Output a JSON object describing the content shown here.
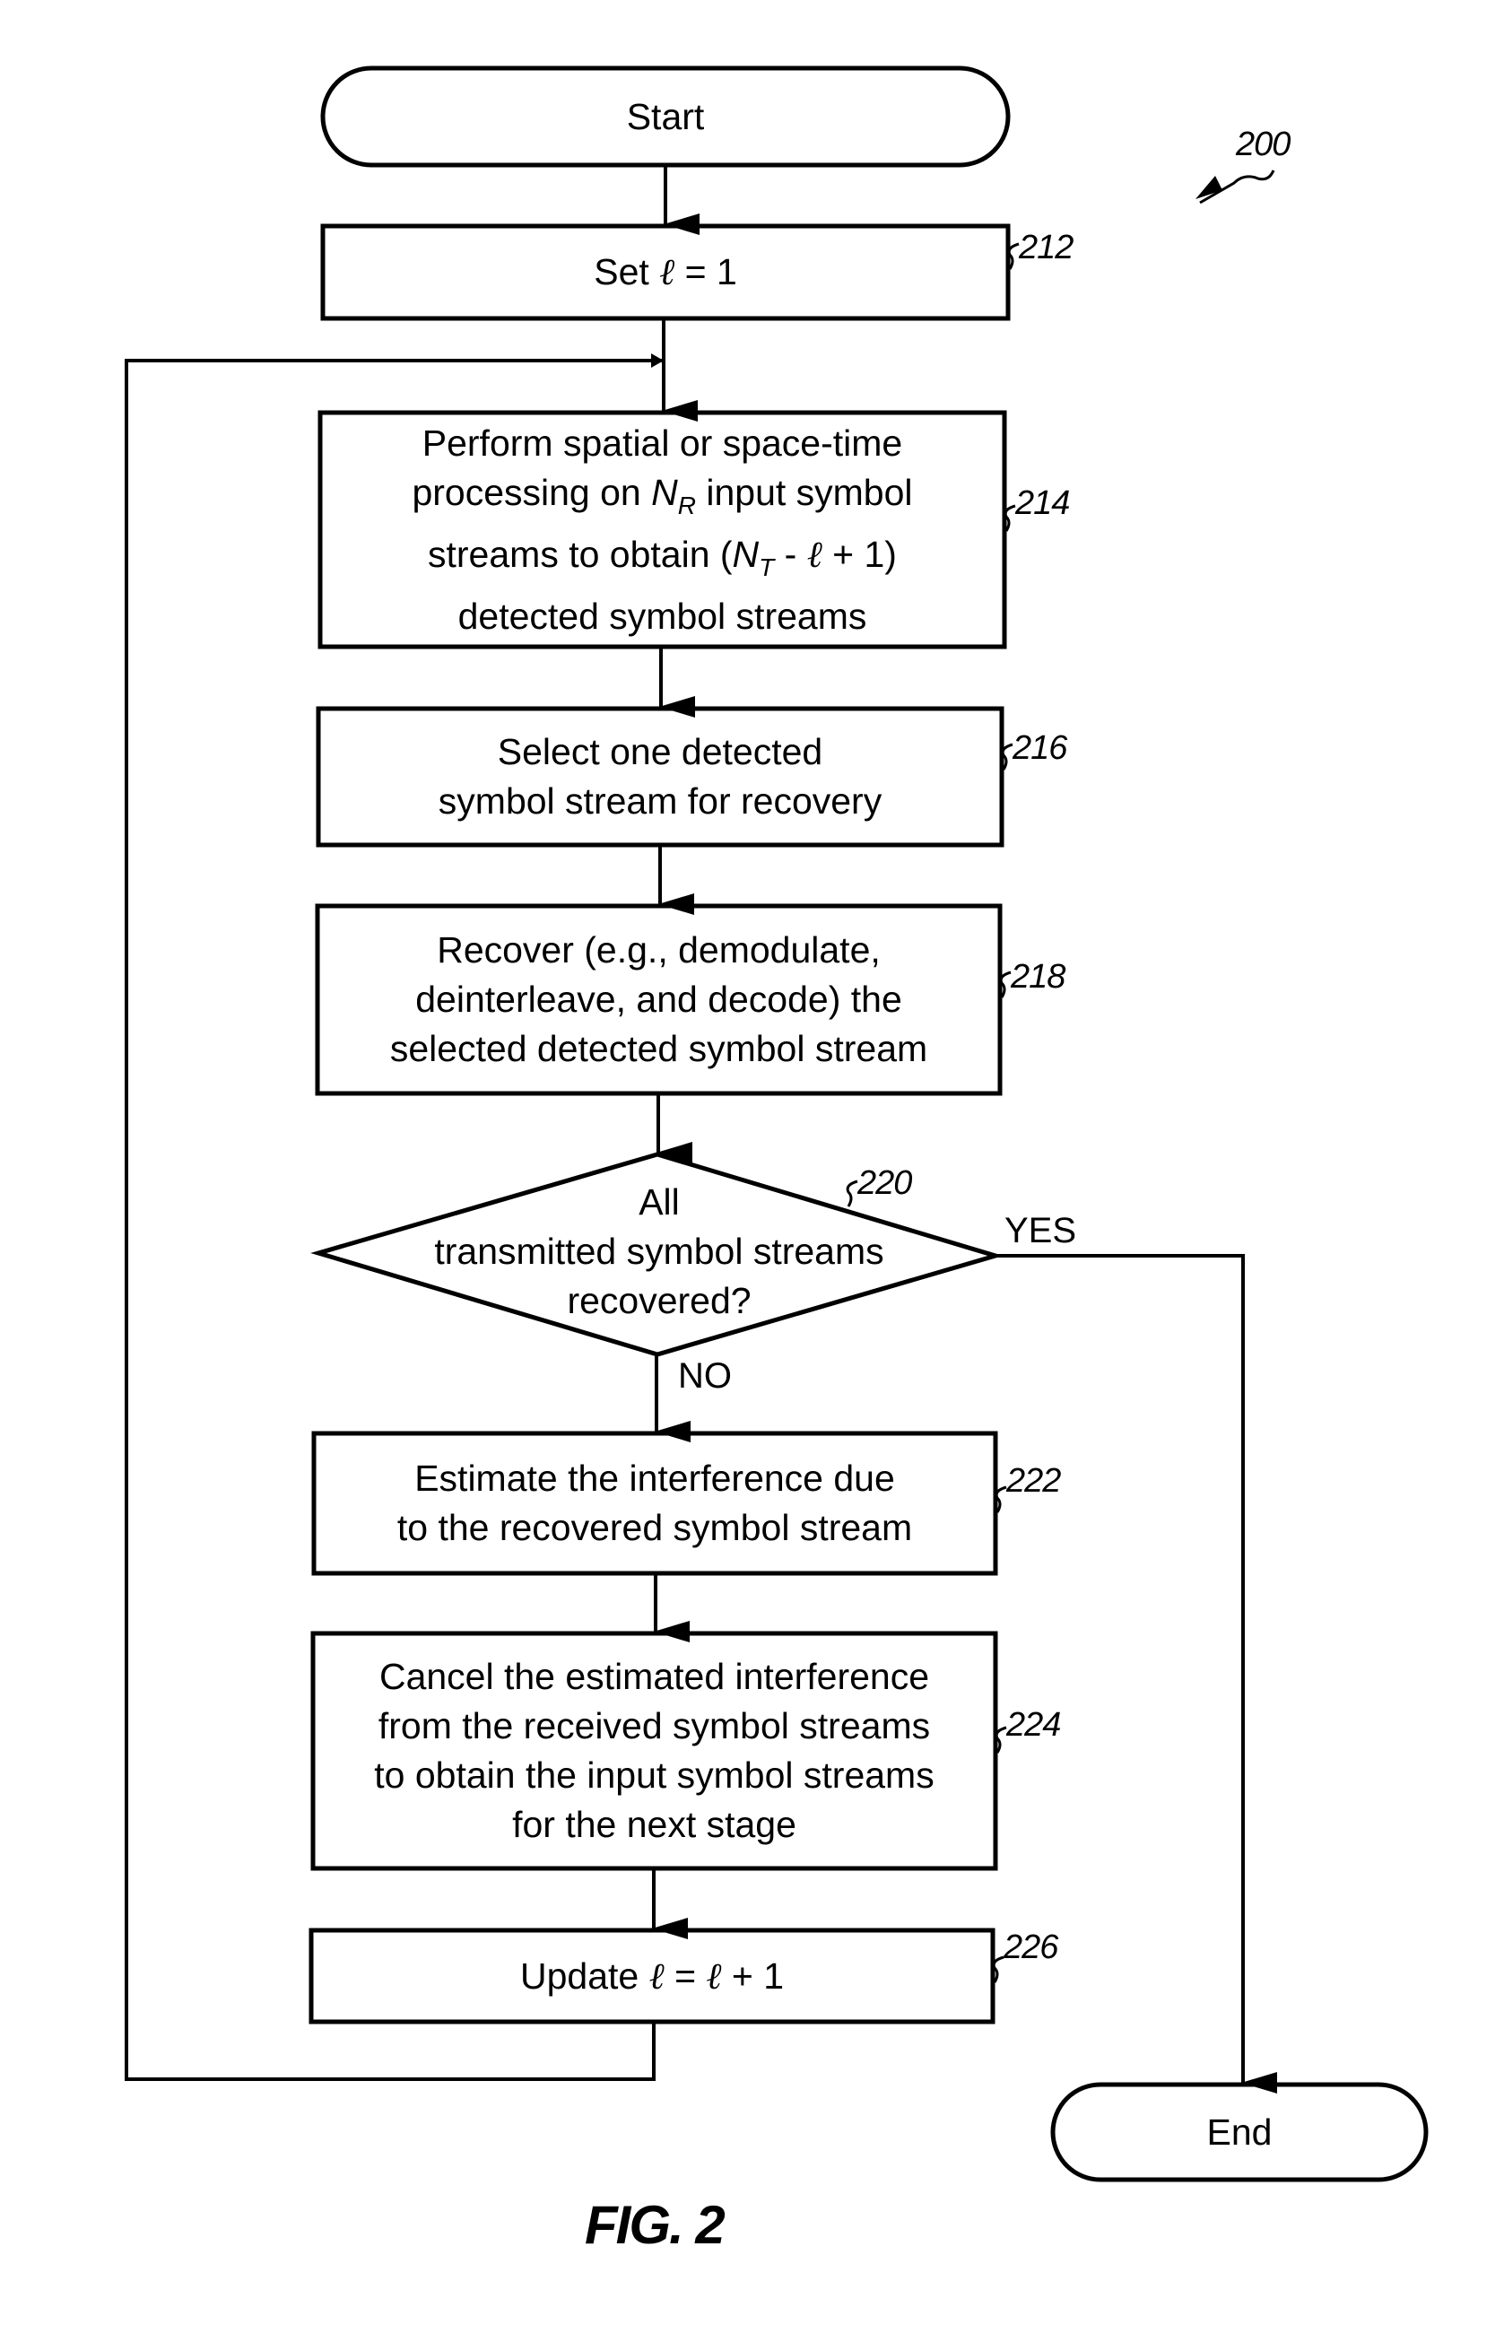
{
  "figure": {
    "label": "FIG. 2",
    "reference": "200"
  },
  "nodes": {
    "start": {
      "type": "terminator",
      "text": "Start"
    },
    "n212": {
      "type": "process",
      "ref": "212",
      "text_prefix": "Set ",
      "var": "ℓ",
      "text_suffix": " = 1"
    },
    "n214": {
      "type": "process",
      "ref": "214",
      "line1": "Perform spatial or space-time",
      "line2_a": "processing on ",
      "line2_var": "N",
      "line2_sub": "R",
      "line2_b": " input symbol",
      "line3_a": "streams to obtain (",
      "line3_var": "N",
      "line3_sub": "T",
      "line3_b": " - ",
      "line3_ell": "ℓ",
      "line3_c": " + 1)",
      "line4": "detected symbol streams"
    },
    "n216": {
      "type": "process",
      "ref": "216",
      "text": "Select one detected\nsymbol stream for recovery"
    },
    "n218": {
      "type": "process",
      "ref": "218",
      "text": "Recover (e.g., demodulate,\ndeinterleave, and decode) the\nselected detected symbol stream"
    },
    "n220": {
      "type": "decision",
      "ref": "220",
      "text": "All\ntransmitted symbol streams\nrecovered?"
    },
    "n222": {
      "type": "process",
      "ref": "222",
      "text": "Estimate the interference due\nto the recovered symbol stream"
    },
    "n224": {
      "type": "process",
      "ref": "224",
      "text": "Cancel the estimated interference\nfrom the received symbol streams\nto obtain the input symbol streams\nfor the next stage"
    },
    "n226": {
      "type": "process",
      "ref": "226",
      "text_prefix": "Update ",
      "var": "ℓ",
      "text_mid": " = ",
      "var2": "ℓ",
      "text_suffix": " + 1"
    },
    "end": {
      "type": "terminator",
      "text": "End"
    }
  },
  "branches": {
    "yes": "YES",
    "no": "NO"
  },
  "edges": [
    {
      "from": "start",
      "to": "n212"
    },
    {
      "from": "n212",
      "to": "n214"
    },
    {
      "from": "n214",
      "to": "n216"
    },
    {
      "from": "n216",
      "to": "n218"
    },
    {
      "from": "n218",
      "to": "n220"
    },
    {
      "from": "n220",
      "to": "n222",
      "label": "NO"
    },
    {
      "from": "n220",
      "to": "end",
      "label": "YES"
    },
    {
      "from": "n222",
      "to": "n224"
    },
    {
      "from": "n224",
      "to": "n226"
    },
    {
      "from": "n226",
      "to": "n214",
      "label": "loop"
    }
  ]
}
